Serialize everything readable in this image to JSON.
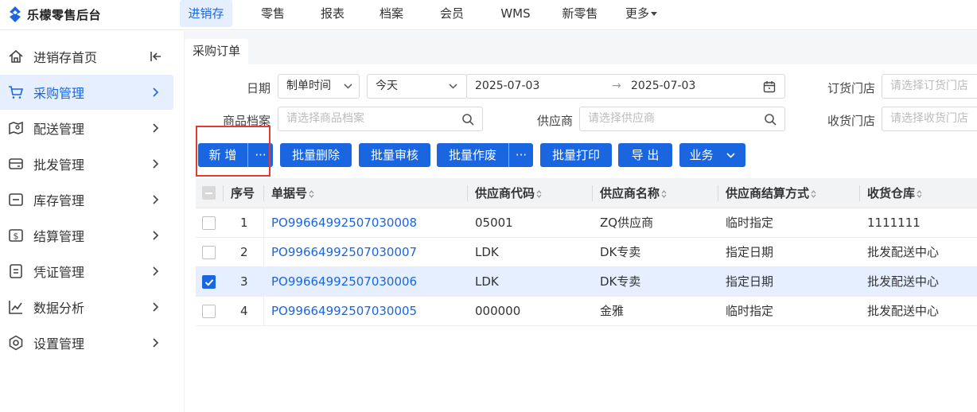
{
  "brand": {
    "name": "乐檬零售后台"
  },
  "topnav": [
    {
      "label": "进销存",
      "active": true
    },
    {
      "label": "零售"
    },
    {
      "label": "报表"
    },
    {
      "label": "档案"
    },
    {
      "label": "会员"
    },
    {
      "label": "WMS"
    },
    {
      "label": "新零售"
    },
    {
      "label": "更多"
    }
  ],
  "sidebar": {
    "items": [
      {
        "label": "进销存首页",
        "icon": "home-icon"
      },
      {
        "label": "采购管理",
        "icon": "cart-icon",
        "active": true
      },
      {
        "label": "配送管理",
        "icon": "map-icon"
      },
      {
        "label": "批发管理",
        "icon": "wallet-icon"
      },
      {
        "label": "库存管理",
        "icon": "box-icon"
      },
      {
        "label": "结算管理",
        "icon": "dollar-icon"
      },
      {
        "label": "凭证管理",
        "icon": "document-icon"
      },
      {
        "label": "数据分析",
        "icon": "chart-icon"
      },
      {
        "label": "设置管理",
        "icon": "settings-icon"
      }
    ]
  },
  "tab": {
    "label": "采购订单"
  },
  "filters": {
    "date_label": "日期",
    "date_type": "制单时间",
    "date_range": "今天",
    "date_start": "2025-07-03",
    "date_end": "2025-07-03",
    "order_store_label": "订货门店",
    "order_store_placeholder": "请选择订货门店",
    "product_label": "商品档案",
    "product_placeholder": "请选择商品档案",
    "supplier_label": "供应商",
    "supplier_placeholder": "请选择供应商",
    "receive_store_label": "收货门店",
    "receive_store_placeholder": "请选择收货门店"
  },
  "toolbar": {
    "add": "新 增",
    "more": "···",
    "batch_delete": "批量删除",
    "batch_audit": "批量审核",
    "batch_void": "批量作废",
    "batch_print": "批量打印",
    "export": "导 出",
    "business": "业务"
  },
  "table": {
    "columns": [
      "序号",
      "单据号",
      "供应商代码",
      "供应商名称",
      "供应商结算方式",
      "收货仓库"
    ],
    "rows": [
      {
        "no": "1",
        "doc": "PO99664992507030008",
        "code": "05001",
        "name": "ZQ供应商",
        "settle": "临时指定",
        "warehouse": "1111111",
        "checked": false
      },
      {
        "no": "2",
        "doc": "PO99664992507030007",
        "code": "LDK",
        "name": "DK专卖",
        "settle": "指定日期",
        "warehouse": "批发配送中心",
        "checked": false
      },
      {
        "no": "3",
        "doc": "PO99664992507030006",
        "code": "LDK",
        "name": "DK专卖",
        "settle": "指定日期",
        "warehouse": "批发配送中心",
        "checked": true
      },
      {
        "no": "4",
        "doc": "PO99664992507030005",
        "code": "000000",
        "name": "金雅",
        "settle": "临时指定",
        "warehouse": "批发配送中心",
        "checked": false
      }
    ]
  },
  "colors": {
    "primary": "#1a66e0",
    "highlight": "#e53935",
    "active_bg": "#e6efff"
  }
}
